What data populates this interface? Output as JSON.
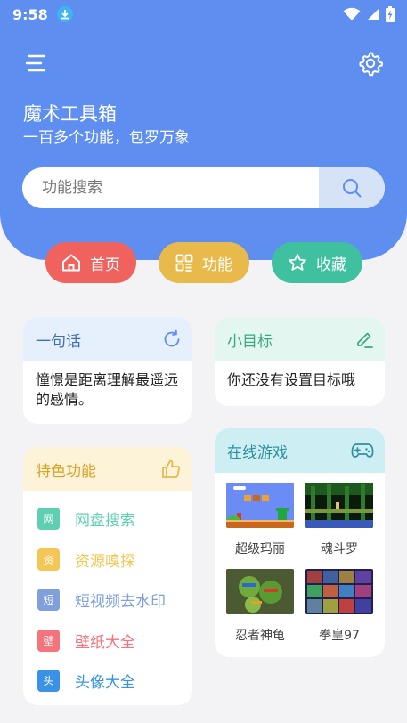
{
  "status_bar": {
    "time": "9:58",
    "icons": [
      "download-icon",
      "wifi-icon",
      "signal-icon",
      "battery-charging-icon"
    ]
  },
  "header": {
    "title": "魔术工具箱",
    "subtitle": "一百多个功能，包罗万象",
    "bg_color": "#5d8ef0"
  },
  "search": {
    "placeholder": "功能搜索",
    "value": ""
  },
  "nav": {
    "items": [
      {
        "label": "首页",
        "icon": "home-icon",
        "color": "#f0625d"
      },
      {
        "label": "功能",
        "icon": "grid-icon",
        "color": "#e8b94b"
      },
      {
        "label": "收藏",
        "icon": "star-icon",
        "color": "#3fc09f"
      }
    ]
  },
  "quote": {
    "title": "一句话",
    "icon": "refresh-icon",
    "text": "憧憬是距离理解最遥远的感情。"
  },
  "goal": {
    "title": "小目标",
    "icon": "edit-icon",
    "text": "你还没有设置目标哦"
  },
  "features": {
    "title": "特色功能",
    "icon": "thumbs-up-icon",
    "items": [
      {
        "badge": "网",
        "label": "网盘搜索",
        "color": "#5ecfb1"
      },
      {
        "badge": "资",
        "label": "资源嗅探",
        "color": "#f4c655"
      },
      {
        "badge": "短",
        "label": "短视频去水印",
        "color": "#7fa0dc"
      },
      {
        "badge": "壁",
        "label": "壁纸大全",
        "color": "#f4737c"
      },
      {
        "badge": "头",
        "label": "头像大全",
        "color": "#3a92e6"
      }
    ]
  },
  "games": {
    "title": "在线游戏",
    "icon": "gamepad-icon",
    "items": [
      {
        "name": "超级玛丽"
      },
      {
        "name": "魂斗罗"
      },
      {
        "name": "忍者神龟"
      },
      {
        "name": "拳皇97"
      }
    ]
  }
}
